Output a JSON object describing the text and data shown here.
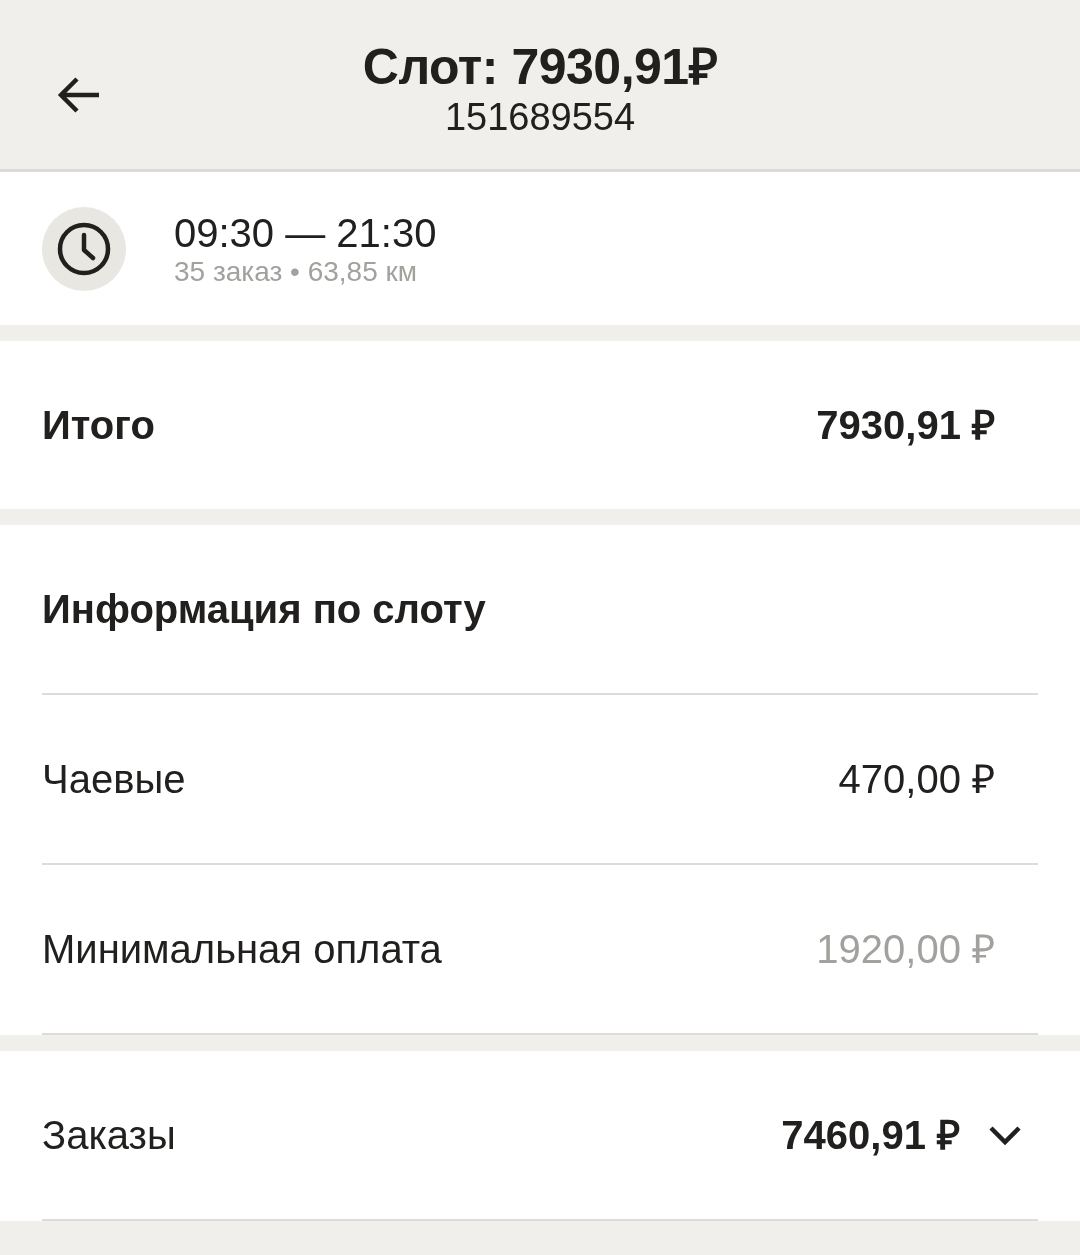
{
  "header": {
    "title": "Слот: 7930,91₽",
    "subtitle": "151689554"
  },
  "slot": {
    "time": "09:30 — 21:30",
    "summary": "35 заказ • 63,85 км"
  },
  "total": {
    "label": "Итого",
    "value": "7930,91 ₽"
  },
  "info": {
    "title": "Информация по слоту",
    "rows": [
      {
        "label": "Чаевые",
        "value": "470,00 ₽",
        "muted": false
      },
      {
        "label": "Минимальная оплата",
        "value": "1920,00 ₽",
        "muted": true
      }
    ]
  },
  "orders": {
    "label": "Заказы",
    "value": "7460,91 ₽",
    "expanded": false
  }
}
